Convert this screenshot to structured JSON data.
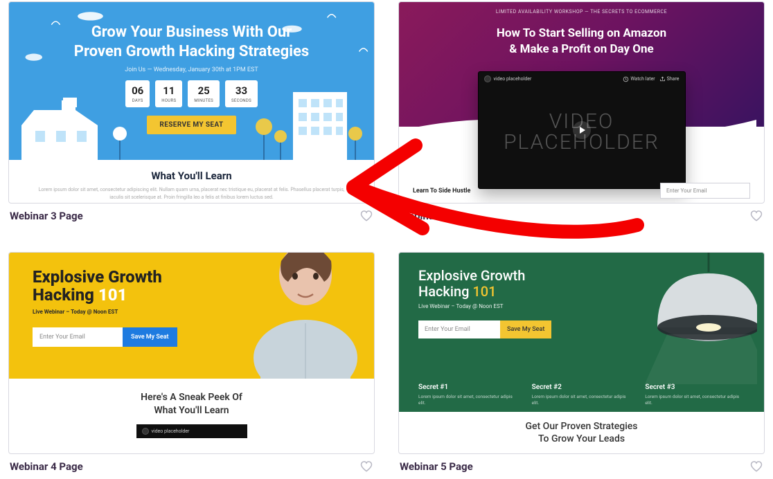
{
  "cards": [
    {
      "title": "Webinar 3 Page",
      "hero": {
        "headline_l1": "Grow Your Business With Our",
        "headline_l2": "Proven Growth Hacking Strategies",
        "subline": "Join Us — Wednesday, January 30th at 1PM EST",
        "countdown": [
          {
            "num": "06",
            "lab": "DAYS"
          },
          {
            "num": "11",
            "lab": "HOURS"
          },
          {
            "num": "25",
            "lab": "MINUTES"
          },
          {
            "num": "33",
            "lab": "SECONDS"
          }
        ],
        "cta": "RESERVE MY SEAT"
      },
      "learn_heading": "What You'll Learn",
      "learn_text": "Lorem ipsum dolor sit amet, consectetur adipiscing elit. Nullam quam urna, placerat nec tristique eu, placerat at felis. Phasellus placerat turpis, iaculis sit scelerisque at. Proin fringilla leo a felis at finibus lorem luctus sed."
    },
    {
      "title": "Webinar 2 Page",
      "bar": "LIMITED AVAILABILITY WORKSHOP — THE SECRETS TO ECOMMERCE",
      "headline_l1": "How To Start Selling on Amazon",
      "headline_l2": "& Make a Profit on Day One",
      "video_label": "video placeholder",
      "watch": "Watch later",
      "share": "Share",
      "video_text_l1": "VIDEO",
      "video_text_l2": "PLACEHOLDER",
      "below_label": "Learn To Side Hustle",
      "email_placeholder": "Enter Your Email"
    },
    {
      "title": "Webinar 4 Page",
      "headline_l1": "Explosive Growth",
      "headline_l2a": "Hacking ",
      "headline_l2b": "101",
      "subline": "Live Webinar – Today @ Noon EST",
      "email_placeholder": "Enter Your Email",
      "submit": "Save My Seat",
      "below_h_l1": "Here's A Sneak Peek Of",
      "below_h_l2": "What You'll Learn",
      "video_label": "video placeholder"
    },
    {
      "title": "Webinar 5 Page",
      "headline_l1": "Explosive Growth",
      "headline_l2a": "Hacking ",
      "headline_l2b": "101",
      "subline": "Live Webinar – Today @ Noon EST",
      "email_placeholder": "Enter Your Email",
      "submit": "Save My Seat",
      "secrets": [
        {
          "h": "Secret #1",
          "p": "Lorem ipsum dolor sit amet, consectetur adipis elit."
        },
        {
          "h": "Secret #2",
          "p": "Lorem ipsum dolor sit amet, consectetur adipis elit."
        },
        {
          "h": "Secret #3",
          "p": "Lorem ipsum dolor sit amet, consectetur adipis elit."
        }
      ],
      "below_l1": "Get Our Proven Strategies",
      "below_l2": "To Grow Your Leads"
    }
  ]
}
